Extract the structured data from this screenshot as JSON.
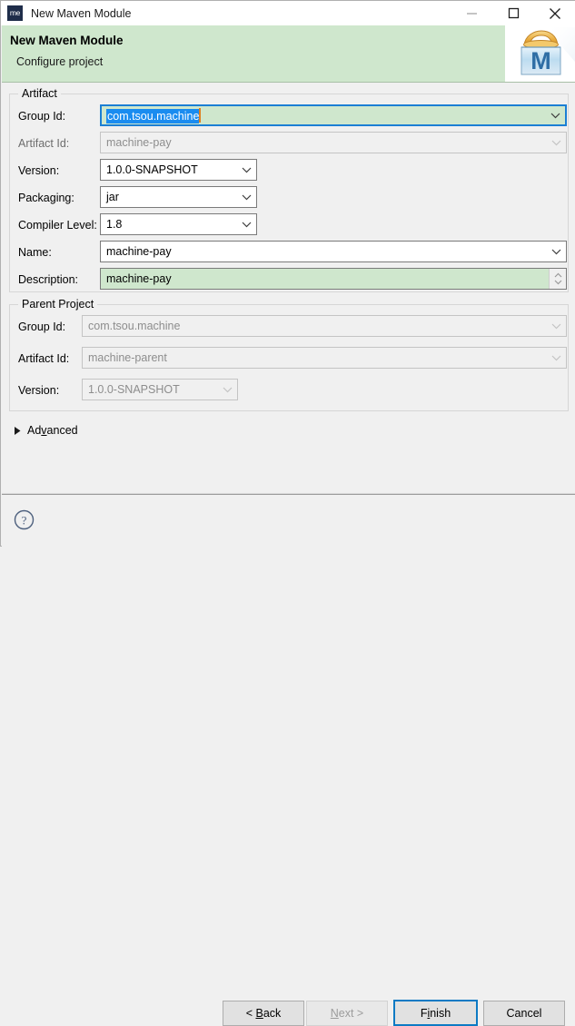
{
  "window": {
    "app_icon_text": "me",
    "title": "New Maven Module",
    "controls": {
      "minimize": "minimize-icon",
      "maximize": "maximize-icon",
      "close": "close-icon"
    }
  },
  "header": {
    "title": "New Maven Module",
    "subtitle": "Configure project",
    "logo_letter": "M",
    "background_color": "#cfe7cd"
  },
  "artifact": {
    "legend": "Artifact",
    "fields": [
      {
        "label": "Group Id:",
        "value": "com.tsou.machine",
        "state": "focused-selected"
      },
      {
        "label": "Artifact Id:",
        "value": "machine-pay",
        "state": "disabled"
      },
      {
        "label": "Version:",
        "value": "1.0.0-SNAPSHOT",
        "state": "combo-short"
      },
      {
        "label": "Packaging:",
        "value": "jar",
        "state": "combo-short"
      },
      {
        "label": "Compiler Level:",
        "value": "1.8",
        "state": "combo-short"
      },
      {
        "label": "Name:",
        "value": "machine-pay",
        "state": "combo-wide"
      },
      {
        "label": "Description:",
        "value": "machine-pay",
        "state": "green-spinner"
      }
    ]
  },
  "parent": {
    "legend": "Parent Project",
    "fields": [
      {
        "label": "Group Id:",
        "value": "com.tsou.machine",
        "state": "disabled"
      },
      {
        "label": "Artifact Id:",
        "value": "machine-parent",
        "state": "disabled"
      },
      {
        "label": "Version:",
        "value": "1.0.0-SNAPSHOT",
        "state": "disabled-short"
      }
    ]
  },
  "advanced": {
    "label_pre": "Ad",
    "label_mnemonic": "v",
    "label_post": "anced",
    "expanded": false
  },
  "footer": {
    "help": "?",
    "buttons": {
      "back_pre": "< ",
      "back_mnemonic": "B",
      "back_post": "ack",
      "next_mnemonic": "N",
      "next_post": "ext >",
      "finish_pre": "F",
      "finish_mnemonic": "i",
      "finish_post": "nish",
      "cancel": "Cancel"
    }
  },
  "colors": {
    "accent_blue": "#0d7ac4",
    "selection_blue": "#1a8cf0",
    "green_field": "#cfe7cd",
    "caret_orange": "#e08020"
  }
}
